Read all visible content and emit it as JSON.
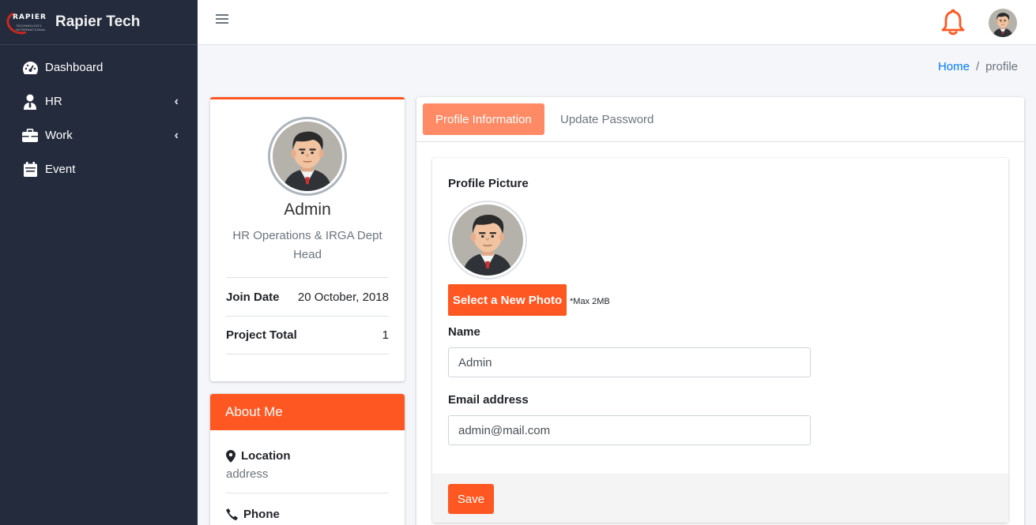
{
  "brand": {
    "logo_text": "RAPIER",
    "logo_sub": "TECHNOLOGY INTERNATIONAL",
    "name": "Rapier Tech"
  },
  "sidebar": {
    "items": [
      {
        "label": "Dashboard",
        "icon": "dashboard-icon",
        "has_submenu": false
      },
      {
        "label": "HR",
        "icon": "user-tie-icon",
        "has_submenu": true
      },
      {
        "label": "Work",
        "icon": "briefcase-icon",
        "has_submenu": true
      },
      {
        "label": "Event",
        "icon": "calendar-icon",
        "has_submenu": false
      }
    ]
  },
  "topbar": {
    "menu_icon": "hamburger-icon",
    "bell_icon": "bell-icon",
    "avatar": "user-avatar"
  },
  "breadcrumb": {
    "home": "Home",
    "separator": "/",
    "current": "profile"
  },
  "profile": {
    "name": "Admin",
    "department": "HR Operations & IRGA Dept Head",
    "join_date_label": "Join Date",
    "join_date_value": "20 October, 2018",
    "project_total_label": "Project Total",
    "project_total_value": "1"
  },
  "about": {
    "title": "About Me",
    "location_label": "Location",
    "location_value": "address",
    "phone_label": "Phone"
  },
  "tabs": [
    {
      "label": "Profile Information",
      "active": true
    },
    {
      "label": "Update Password",
      "active": false
    }
  ],
  "form": {
    "picture_label": "Profile Picture",
    "select_photo_label": "Select a New Photo",
    "max_note": "*Max 2MB",
    "name_label": "Name",
    "name_value": "Admin",
    "email_label": "Email address",
    "email_value": "admin@mail.com",
    "save_label": "Save"
  },
  "colors": {
    "accent": "#ff5722",
    "tab_active": "#ff8a65",
    "sidebar": "#232b3c",
    "link": "#007bff"
  }
}
